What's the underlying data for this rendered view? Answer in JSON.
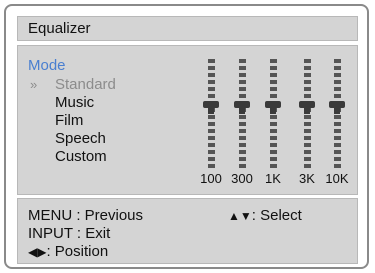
{
  "window": {
    "title": "Equalizer"
  },
  "mode": {
    "heading": "Mode",
    "items": [
      {
        "label": "Standard",
        "selected": true,
        "marker": "»"
      },
      {
        "label": "Music",
        "selected": false
      },
      {
        "label": "Film",
        "selected": false
      },
      {
        "label": "Speech",
        "selected": false
      },
      {
        "label": "Custom",
        "selected": false
      }
    ]
  },
  "equalizer": {
    "bands": [
      {
        "label": "100",
        "level": 0.5
      },
      {
        "label": "300",
        "level": 0.5
      },
      {
        "label": "1K",
        "level": 0.5
      },
      {
        "label": "3K",
        "level": 0.5
      },
      {
        "label": "10K",
        "level": 0.5
      }
    ]
  },
  "help": {
    "previous": "MENU : Previous",
    "exit": "INPUT : Exit",
    "select_arrows": "▲▼",
    "select": ": Select",
    "position_arrows": "◀▶",
    "position": ": Position"
  }
}
